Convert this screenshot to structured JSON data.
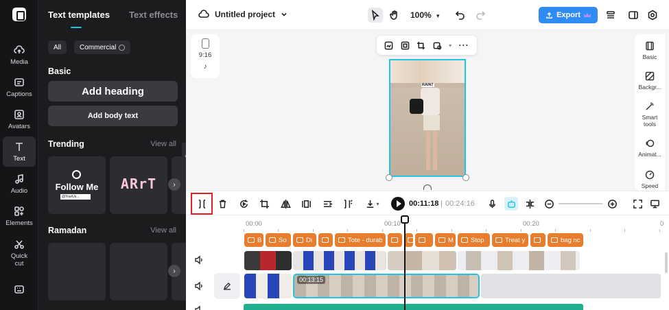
{
  "rail": {
    "items": [
      {
        "label": "Media",
        "icon": "cloud-upload-icon"
      },
      {
        "label": "Captions",
        "icon": "captions-icon"
      },
      {
        "label": "Avatars",
        "icon": "avatar-icon"
      },
      {
        "label": "Text",
        "icon": "text-icon"
      },
      {
        "label": "Audio",
        "icon": "music-icon"
      },
      {
        "label": "Elements",
        "icon": "elements-icon"
      },
      {
        "label": "Quick cut",
        "icon": "scissors-icon"
      },
      {
        "label": "",
        "icon": "keyboard-icon"
      }
    ]
  },
  "panel": {
    "tabs": [
      "Text templates",
      "Text effects"
    ],
    "chips": [
      "All",
      "Commercial"
    ],
    "basic_title": "Basic",
    "add_heading": "Add heading",
    "add_body": "Add body text",
    "trending_title": "Trending",
    "ramadan_title": "Ramadan",
    "view_all": "View all",
    "trending_cards": [
      {
        "text": "Follow Me",
        "sub": "@YourUs..."
      },
      {
        "text": "ARrT"
      }
    ]
  },
  "topbar": {
    "project_title": "Untitled project",
    "zoom": "100%",
    "export_label": "Export"
  },
  "canvas": {
    "ratio": "9:16",
    "frame_caption": "RAIN7"
  },
  "right_panel": {
    "items": [
      "Basic",
      "Backgr...",
      "Smart tools",
      "Animat...",
      "Speed"
    ]
  },
  "timeline": {
    "current_time": "00:11:18",
    "separator": "|",
    "total_time": "00:24:16",
    "ruler": [
      "00:00",
      "00:10",
      "00:20"
    ],
    "clip_time": "00:13:15",
    "text_clips": [
      "B",
      "So",
      "Di",
      "",
      "Tote - durab",
      "",
      "",
      "",
      "M",
      "Stop",
      "Treat y",
      "",
      "bag nc"
    ]
  },
  "colors": {
    "accent": "#22c4e6",
    "export": "#2f8cf4",
    "text_clip": "#e87d2d",
    "audio_strip": "#1fae8e",
    "highlight": "#e02020"
  }
}
